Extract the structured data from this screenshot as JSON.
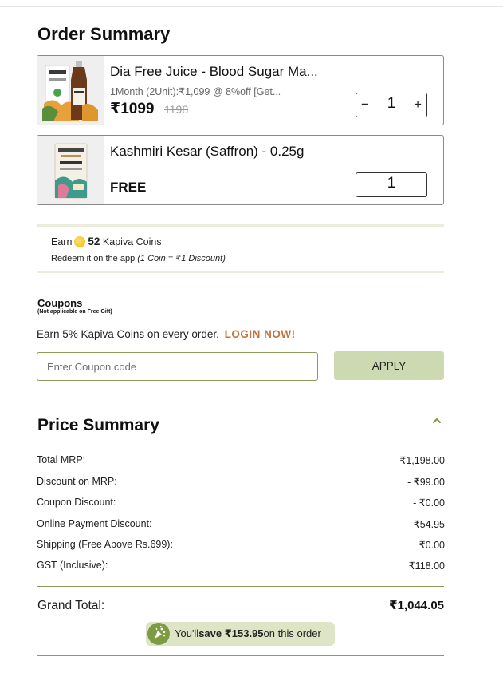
{
  "order_summary": {
    "title": "Order Summary",
    "items": [
      {
        "name": "Dia Free Juice - Blood Sugar Ma...",
        "variant": "1Month (2Unit):₹1,099 @ 8%off [Get...",
        "price": "₹1099",
        "mrp": "1198",
        "quantity": "1",
        "minus_label": "−",
        "plus_label": "+"
      },
      {
        "name": "Kashmiri Kesar (Saffron) - 0.25g",
        "price_label": "FREE",
        "quantity": "1"
      }
    ]
  },
  "coins": {
    "earn_prefix": "Earn",
    "amount": "52",
    "earn_suffix": "Kapiva Coins",
    "redeem_text": "Redeem it on the app",
    "redeem_note": "(1 Coin = ₹1 Discount)"
  },
  "coupons": {
    "title": "Coupons",
    "note": "(Not applicable on Free Gift)",
    "earn_text": "Earn 5% Kapiva Coins on every order.",
    "login_label": "LOGIN NOW!",
    "placeholder": "Enter Coupon code",
    "apply_label": "APPLY"
  },
  "price_summary": {
    "title": "Price Summary",
    "rows": [
      {
        "label": "Total MRP:",
        "value": "₹1,198.00"
      },
      {
        "label": "Discount on MRP:",
        "value": "- ₹99.00"
      },
      {
        "label": "Coupon Discount:",
        "value": "- ₹0.00"
      },
      {
        "label": "Online Payment Discount:",
        "value": "- ₹54.95"
      },
      {
        "label": "Shipping (Free Above Rs.699):",
        "value": "₹0.00"
      },
      {
        "label": "GST (Inclusive):",
        "value": "₹118.00"
      }
    ],
    "grand_total_label": "Grand Total:",
    "grand_total_value": "₹1,044.05",
    "savings_prefix": "You'll",
    "savings_amount": "save ₹153.95",
    "savings_suffix": "on this order"
  },
  "colors": {
    "accent": "#8d9a5b",
    "apply_bg": "#cdd9b1",
    "login": "#c4733f",
    "savings_bg": "#dde5c6"
  }
}
